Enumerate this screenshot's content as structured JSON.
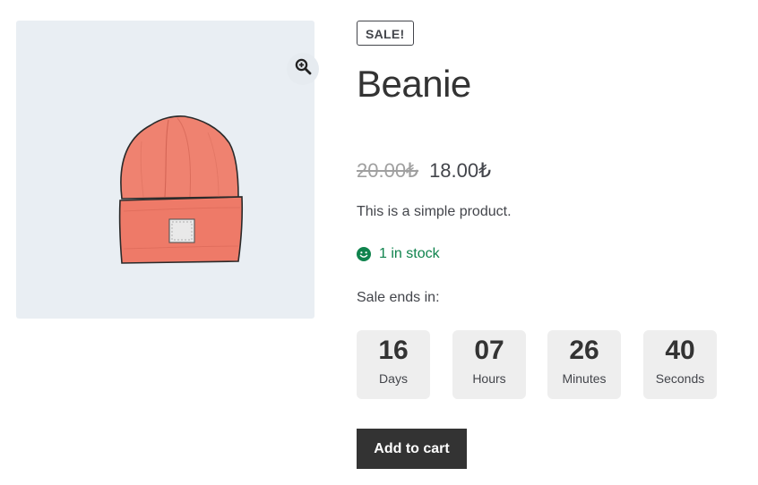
{
  "product": {
    "badge": "SALE!",
    "title": "Beanie",
    "price_old": "20.00₺",
    "price_new": "18.00₺",
    "description": "This is a simple product.",
    "stock": "1 in stock"
  },
  "countdown": {
    "label": "Sale ends in:",
    "units": [
      {
        "value": "16",
        "label": "Days"
      },
      {
        "value": "07",
        "label": "Hours"
      },
      {
        "value": "26",
        "label": "Minutes"
      },
      {
        "value": "40",
        "label": "Seconds"
      }
    ]
  },
  "cart": {
    "button_label": "Add to cart"
  },
  "icons": {
    "zoom": "zoom-in-icon",
    "stock": "smile-icon",
    "product_image": "beanie-image"
  },
  "colors": {
    "button_bg": "#333333",
    "stock_green": "#0f834d",
    "gallery_bg": "#e9eef3",
    "timer_box": "#eeeeee",
    "beanie": "#ee7a68"
  }
}
